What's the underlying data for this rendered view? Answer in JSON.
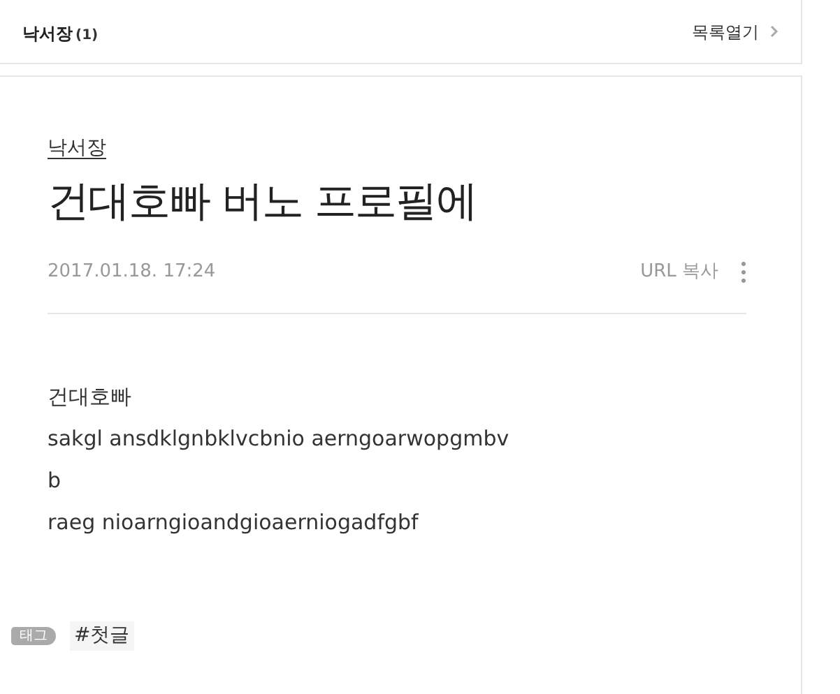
{
  "header": {
    "title": "낙서장",
    "count": "(1)",
    "list_toggle": "목록열기"
  },
  "post": {
    "category": "낙서장",
    "title": "건대호빠 버노 프로필에",
    "date": "2017.01.18. 17:24",
    "copy_url": "URL 복사",
    "body": [
      "건대호빠",
      "sakgl ansdklgnbklvcbnio aerngoarwopgmbv",
      "b",
      "raeg nioarngioandgioaerniogadfgbf"
    ],
    "tag_label": "태그",
    "tags": [
      "#첫글"
    ]
  }
}
